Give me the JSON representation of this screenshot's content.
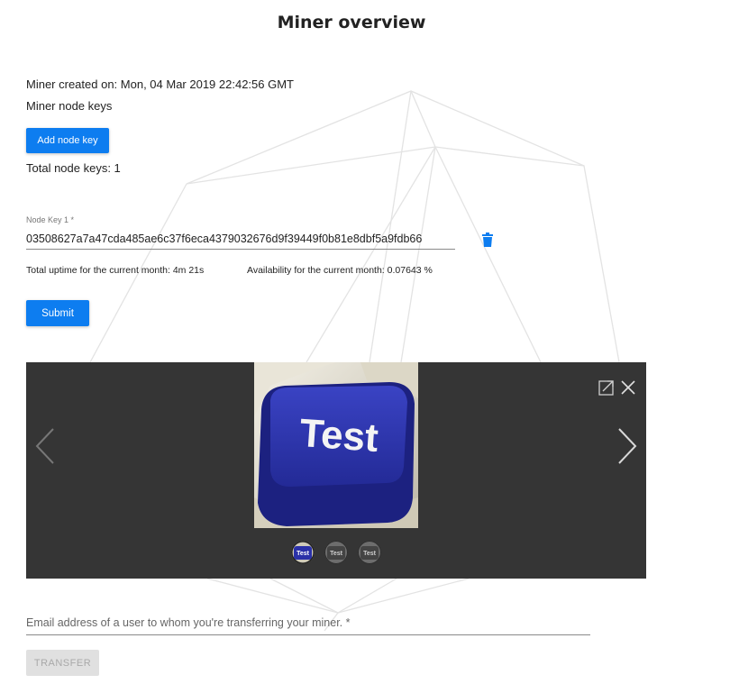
{
  "page": {
    "title": "Miner overview"
  },
  "miner": {
    "created_text": "Miner created on: Mon, 04 Mar 2019 22:42:56 GMT",
    "node_keys_heading": "Miner node keys",
    "add_node_key_label": "Add node key",
    "total_node_keys_text": "Total node keys: 1"
  },
  "node_key_1": {
    "label": "Node Key 1 *",
    "value": "03508627a7a47cda485ae6c37f6eca4379032676d9f39449f0b81e8dbf5a9fdb66",
    "uptime_text": "Total uptime for the current month: 4m 21s",
    "availability_text": "Availability for the current month: 0.07643 %",
    "delete_icon": "trash-icon"
  },
  "form": {
    "submit_label": "Submit"
  },
  "gallery": {
    "image_text": "Test",
    "thumbnail_text": "Test",
    "thumbnail_count": 3,
    "active_thumbnail": 1,
    "icons": {
      "prev": "chevron-left-icon",
      "next": "chevron-right-icon",
      "fullscreen": "fullscreen-icon",
      "close": "close-icon"
    }
  },
  "transfer": {
    "email_placeholder": "Email address of a user to whom you're transferring your miner. *",
    "email_value": "",
    "button_label": "TRANSFER"
  },
  "colors": {
    "primary": "#0d7df0",
    "gallery_background": "#353535",
    "key_blue": "#2b31a8",
    "disabled_background": "#e0e0e0",
    "disabled_text": "#a9a9a9"
  }
}
